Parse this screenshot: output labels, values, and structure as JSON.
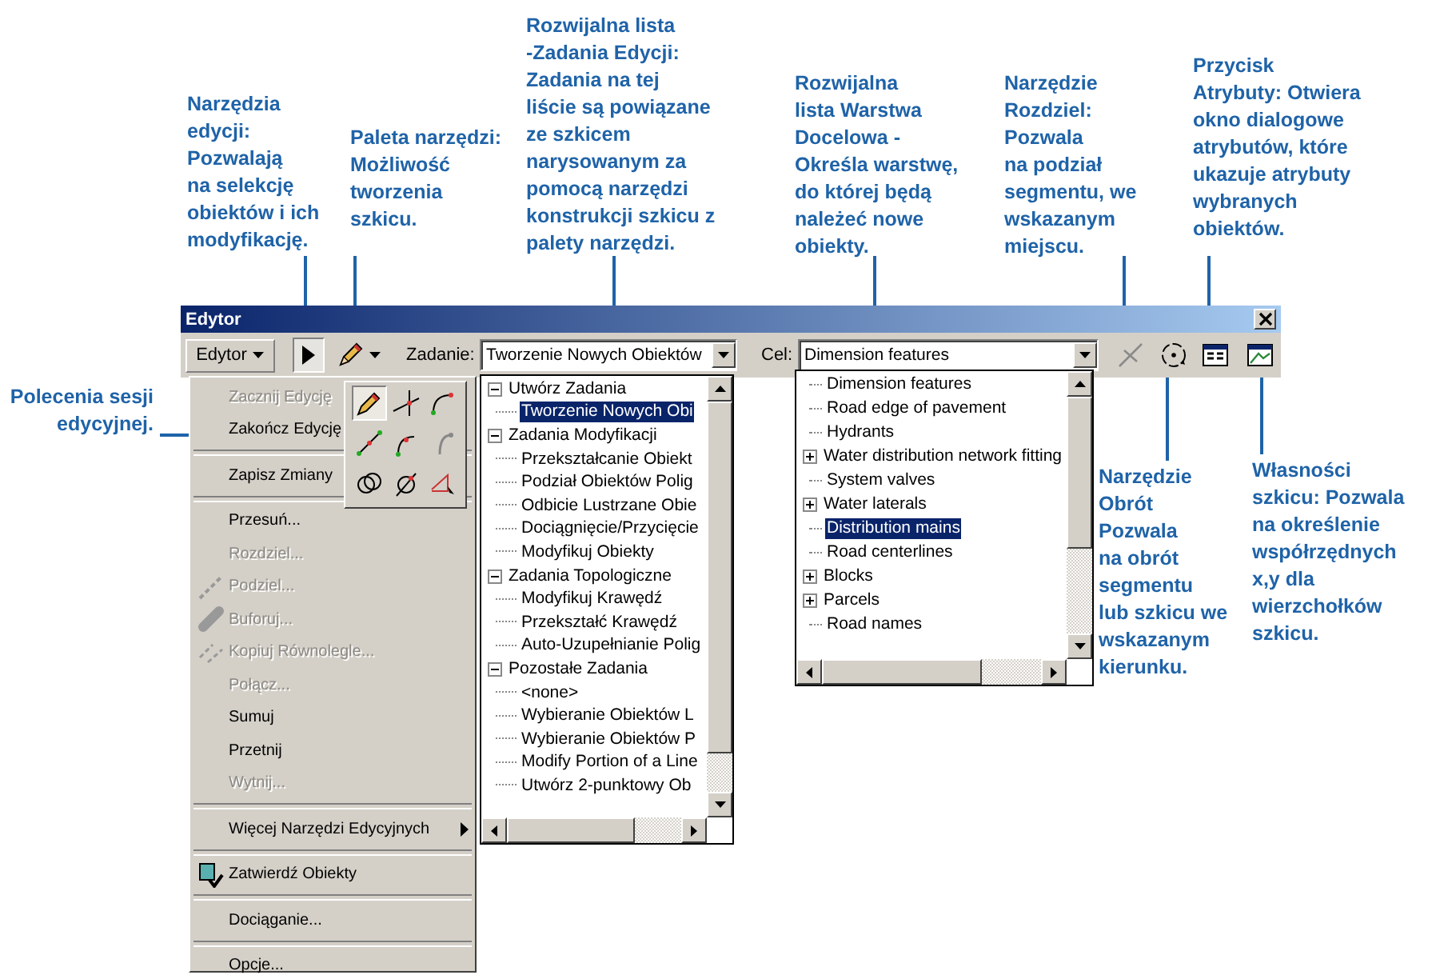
{
  "callouts": [
    {
      "lines": [
        "Narzędzia",
        "edycji:",
        "Pozwalają",
        "na selekcję",
        "obiektów i ich",
        "modyfikację."
      ]
    },
    {
      "lines": [
        "Paleta narzędzi:",
        "Możliwość",
        "tworzenia",
        "szkicu."
      ]
    },
    {
      "lines": [
        "Rozwijalna lista",
        "-Zadania Edycji:",
        "Zadania na tej",
        "liście są powiązane",
        "ze szkicem",
        "narysowanym za",
        "pomocą narzędzi",
        "konstrukcji szkicu z",
        "palety narzędzi."
      ]
    },
    {
      "lines": [
        "Rozwijalna",
        "lista Warstwa",
        "Docelowa -",
        "Określa warstwę,",
        "do której będą",
        "należeć nowe",
        "obiekty."
      ]
    },
    {
      "lines": [
        "Narzędzie",
        "Rozdziel:",
        "Pozwala",
        "na podział",
        "segmentu, we",
        "wskazanym",
        "miejscu."
      ]
    },
    {
      "lines": [
        "Przycisk",
        "Atrybuty: Otwiera",
        "okno dialogowe",
        "atrybutów, które",
        "ukazuje atrybuty",
        "wybranych",
        "obiektów."
      ]
    },
    {
      "lines": [
        "Polecenia sesji",
        "edycyjnej."
      ]
    },
    {
      "lines": [
        "Narzędzie",
        "Obrót",
        "Pozwala",
        "na obrót",
        "segmentu",
        "lub szkicu we",
        "wskazanym",
        "kierunku."
      ]
    },
    {
      "lines": [
        "Własności",
        "szkicu: Pozwala",
        "na określenie",
        "współrzędnych",
        "x,y dla",
        "wierzchołków",
        "szkicu."
      ]
    }
  ],
  "window": {
    "title": "Edytor"
  },
  "toolbar": {
    "editor_menu": "Edytor",
    "task_label": "Zadanie:",
    "task_value": "Tworzenie Nowych Obiektów",
    "target_label": "Cel:",
    "target_value": "Dimension features"
  },
  "menu": [
    {
      "kind": "item",
      "label": "Zacznij Edycję",
      "disabled": true
    },
    {
      "kind": "item",
      "label": "Zakończ Edycję",
      "disabled": false
    },
    {
      "kind": "separator"
    },
    {
      "kind": "item",
      "label": "Zapisz Zmiany",
      "disabled": false
    },
    {
      "kind": "separator"
    },
    {
      "kind": "item",
      "label": "Przesuń...",
      "disabled": false
    },
    {
      "kind": "item",
      "label": "Rozdziel...",
      "disabled": true
    },
    {
      "kind": "split",
      "label": "Podziel...",
      "disabled": true
    },
    {
      "kind": "buffer",
      "label": "Buforuj...",
      "disabled": true
    },
    {
      "kind": "parallel",
      "label": "Kopiuj Równolegle...",
      "disabled": true
    },
    {
      "kind": "item",
      "label": "Połącz...",
      "disabled": true
    },
    {
      "kind": "item",
      "label": "Sumuj",
      "disabled": false
    },
    {
      "kind": "item",
      "label": "Przetnij",
      "disabled": false
    },
    {
      "kind": "item",
      "label": "Wytnij...",
      "disabled": true
    },
    {
      "kind": "separator"
    },
    {
      "kind": "submenu",
      "label": "Więcej Narzędzi Edycyjnych",
      "disabled": false
    },
    {
      "kind": "separator"
    },
    {
      "kind": "validate",
      "label": "Zatwierdź Obiekty",
      "disabled": false
    },
    {
      "kind": "separator"
    },
    {
      "kind": "item",
      "label": "Dociąganie...",
      "disabled": false
    },
    {
      "kind": "separator"
    },
    {
      "kind": "item",
      "label": "Opcje...",
      "disabled": false
    }
  ],
  "palette": [
    {
      "kind": "pencil",
      "selected": true
    },
    {
      "kind": "intersection",
      "selected": false
    },
    {
      "kind": "arc",
      "selected": false
    },
    {
      "kind": "midpoint",
      "selected": false
    },
    {
      "kind": "tangent",
      "selected": false
    },
    {
      "kind": "grey-arc",
      "selected": false
    },
    {
      "kind": "distance",
      "selected": false
    },
    {
      "kind": "direction",
      "selected": false
    },
    {
      "kind": "trace",
      "selected": false
    }
  ],
  "tasks": [
    {
      "label": "Utwórz Zadania",
      "children": [
        {
          "label": "Tworzenie Nowych Obi",
          "selected": true
        }
      ]
    },
    {
      "label": "Zadania Modyfikacji",
      "children": [
        {
          "label": "Przekształcanie Obiekt",
          "selected": false
        },
        {
          "label": "Podział Obiektów Polig",
          "selected": false
        },
        {
          "label": "Odbicie Lustrzane Obie",
          "selected": false
        },
        {
          "label": "Dociągnięcie/Przycięcie",
          "selected": false
        },
        {
          "label": "Modyfikuj Obiekty",
          "selected": false
        }
      ]
    },
    {
      "label": "Zadania Topologiczne",
      "children": [
        {
          "label": "Modyfikuj Krawędź",
          "selected": false
        },
        {
          "label": "Przekształć Krawędź",
          "selected": false
        },
        {
          "label": "Auto-Uzupełnianie Polig",
          "selected": false
        }
      ]
    },
    {
      "label": "Pozostałe Zadania",
      "children": [
        {
          "label": "<none>",
          "selected": false
        },
        {
          "label": "Wybieranie Obiektów L",
          "selected": false
        },
        {
          "label": "Wybieranie Obiektów P",
          "selected": false
        },
        {
          "label": "Modify Portion of a Line",
          "selected": false
        },
        {
          "label": "Utwórz 2-punktowy Ob",
          "selected": false
        }
      ]
    }
  ],
  "layers": [
    {
      "label": "Dimension features",
      "expandable": false,
      "selected": false
    },
    {
      "label": "Road edge of pavement",
      "expandable": false,
      "selected": false
    },
    {
      "label": "Hydrants",
      "expandable": false,
      "selected": false
    },
    {
      "label": "Water distribution network fitting",
      "expandable": true,
      "selected": false
    },
    {
      "label": "System valves",
      "expandable": false,
      "selected": false
    },
    {
      "label": "Water laterals",
      "expandable": true,
      "selected": false
    },
    {
      "label": "Distribution mains",
      "expandable": false,
      "selected": true
    },
    {
      "label": "Road centerlines",
      "expandable": false,
      "selected": false
    },
    {
      "label": "Blocks",
      "expandable": true,
      "selected": false
    },
    {
      "label": "Parcels",
      "expandable": true,
      "selected": false
    },
    {
      "label": "Road names",
      "expandable": false,
      "selected": false
    }
  ]
}
